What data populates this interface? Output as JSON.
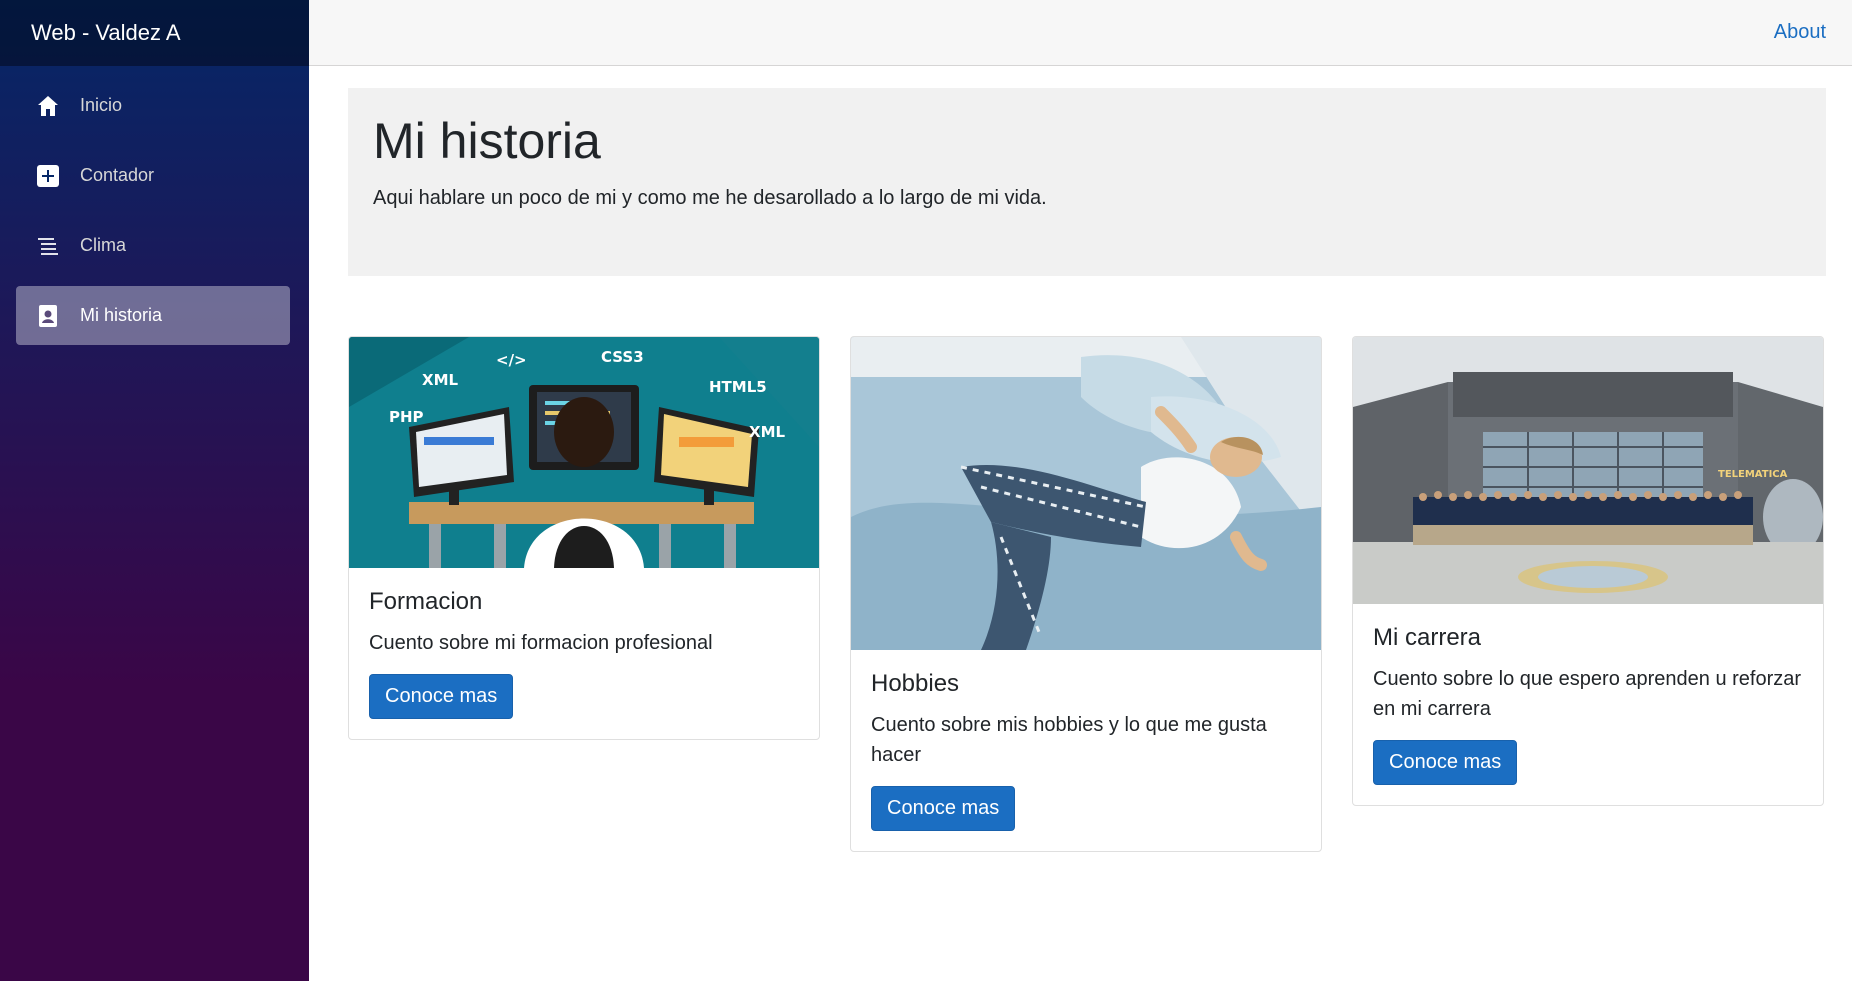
{
  "sidebar": {
    "brand": "Web - Valdez A",
    "items": [
      {
        "label": "Inicio",
        "icon": "home-icon"
      },
      {
        "label": "Contador",
        "icon": "plus-icon"
      },
      {
        "label": "Clima",
        "icon": "list-icon"
      },
      {
        "label": "Mi historia",
        "icon": "person-badge-icon"
      }
    ],
    "active_index": 3
  },
  "topbar": {
    "about_link": "About"
  },
  "jumbotron": {
    "title": "Mi historia",
    "text": "Aqui hablare un poco de mi y como me he desarollado a lo largo de mi vida."
  },
  "cards": [
    {
      "title": "Formacion",
      "text": "Cuento sobre mi formacion profesional",
      "button": "Conoce mas",
      "image_labels": [
        "XML",
        "</>",
        "CSS3",
        "HTML5",
        "PHP",
        "XML"
      ]
    },
    {
      "title": "Hobbies",
      "text": "Cuento sobre mis hobbies y lo que me gusta hacer",
      "button": "Conoce mas"
    },
    {
      "title": "Mi carrera",
      "text": "Cuento sobre lo que espero aprenden u reforzar en mi carrera",
      "button": "Conoce mas",
      "image_labels": [
        "TELEMATICA"
      ]
    }
  ],
  "colors": {
    "accent": "#1b6ec2",
    "sidebar_top": "#052767",
    "sidebar_bottom": "#3a0647"
  }
}
